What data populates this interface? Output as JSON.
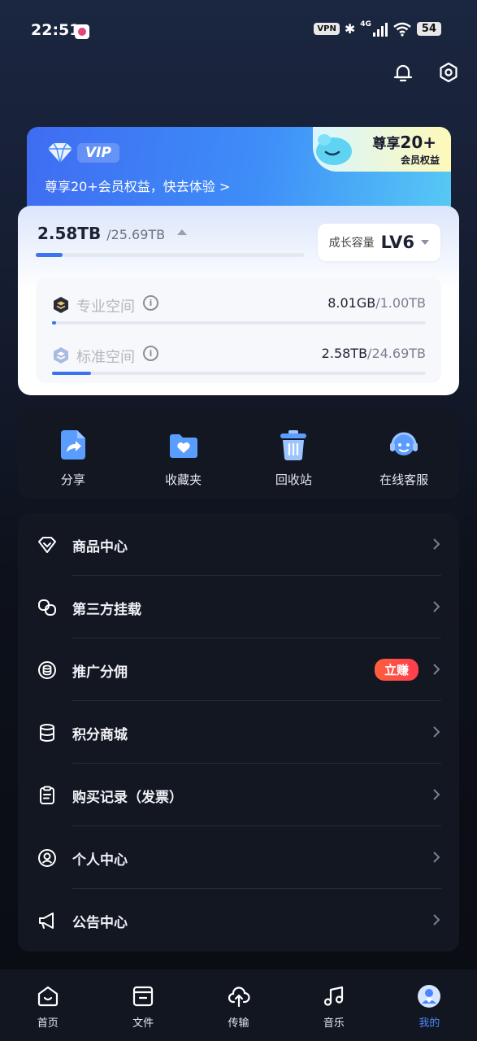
{
  "status_bar": {
    "time": "22:51",
    "vpn": "VPN",
    "network": "4G",
    "battery": "54"
  },
  "vip_banner": {
    "tag": "VIP",
    "text": "尊享20+会员权益，快去体验 >",
    "badge_prefix": "尊享",
    "badge_number": "20+",
    "badge_sub": "会员权益"
  },
  "storage": {
    "used": "2.58TB",
    "total": "/25.69TB",
    "used_fraction": 0.1,
    "level_label": "成长容量",
    "level_value": "LV6",
    "rows": [
      {
        "name": "专业空间",
        "value": "8.01GB",
        "total": "/1.00TB",
        "fraction": 0.008
      },
      {
        "name": "标准空间",
        "value": "2.58TB",
        "total": "/24.69TB",
        "fraction": 0.105
      }
    ]
  },
  "quick_actions": [
    {
      "label": "分享",
      "icon": "share-icon"
    },
    {
      "label": "收藏夹",
      "icon": "favorites-folder-icon"
    },
    {
      "label": "回收站",
      "icon": "trash-icon"
    },
    {
      "label": "在线客服",
      "icon": "customer-service-icon"
    }
  ],
  "menu": [
    {
      "label": "商品中心",
      "icon": "diamond-icon"
    },
    {
      "label": "第三方挂载",
      "icon": "link-icon"
    },
    {
      "label": "推广分佣",
      "icon": "coin-icon",
      "badge": "立赚"
    },
    {
      "label": "积分商城",
      "icon": "points-stack-icon"
    },
    {
      "label": "购买记录（发票）",
      "icon": "receipt-icon"
    },
    {
      "label": "个人中心",
      "icon": "user-icon"
    },
    {
      "label": "公告中心",
      "icon": "megaphone-icon"
    }
  ],
  "tabs": [
    {
      "label": "首页",
      "icon": "home-icon"
    },
    {
      "label": "文件",
      "icon": "folder-icon"
    },
    {
      "label": "传输",
      "icon": "cloud-transfer-icon"
    },
    {
      "label": "音乐",
      "icon": "music-icon"
    },
    {
      "label": "我的",
      "icon": "profile-icon",
      "active": true
    }
  ],
  "colors": {
    "accent": "#3b73f0",
    "tab_active": "#4a86ff",
    "earn_badge": "#ff4a45"
  }
}
